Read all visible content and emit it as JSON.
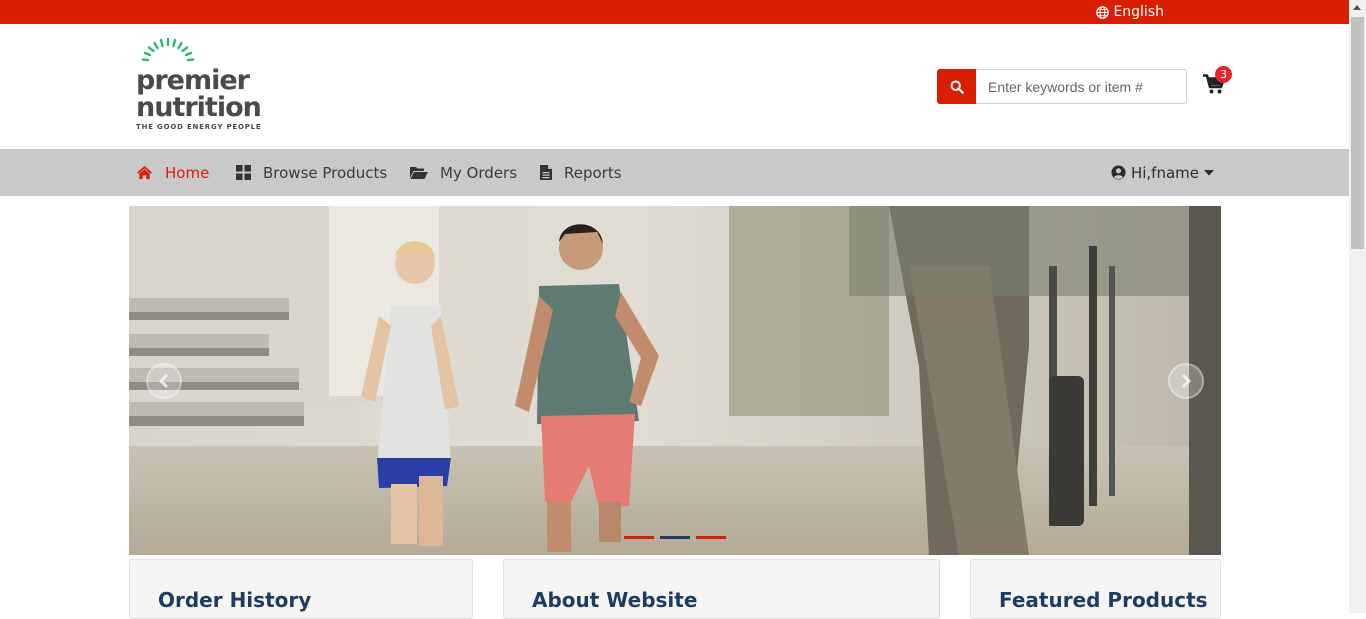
{
  "topbar": {
    "language_label": "English",
    "color": "#d81e05"
  },
  "logo": {
    "line1": "premier",
    "line2": "nutrition",
    "tagline": "THE GOOD ENERGY PEOPLE",
    "accent": "#2eb872"
  },
  "search": {
    "placeholder": "Enter keywords or item #",
    "value": ""
  },
  "cart": {
    "count": "3"
  },
  "nav": {
    "items": [
      {
        "label": "Home",
        "icon": "home-icon",
        "active": true
      },
      {
        "label": "Browse Products",
        "icon": "grid-icon",
        "active": false
      },
      {
        "label": "My Orders",
        "icon": "folder-open-icon",
        "active": false
      },
      {
        "label": "Reports",
        "icon": "file-icon",
        "active": false
      }
    ],
    "user_label": "Hi,fname"
  },
  "carousel": {
    "slide_count": 3,
    "active_index": 1
  },
  "cards": [
    {
      "title": "Order History"
    },
    {
      "title": "About Website"
    },
    {
      "title": "Featured Products"
    }
  ]
}
